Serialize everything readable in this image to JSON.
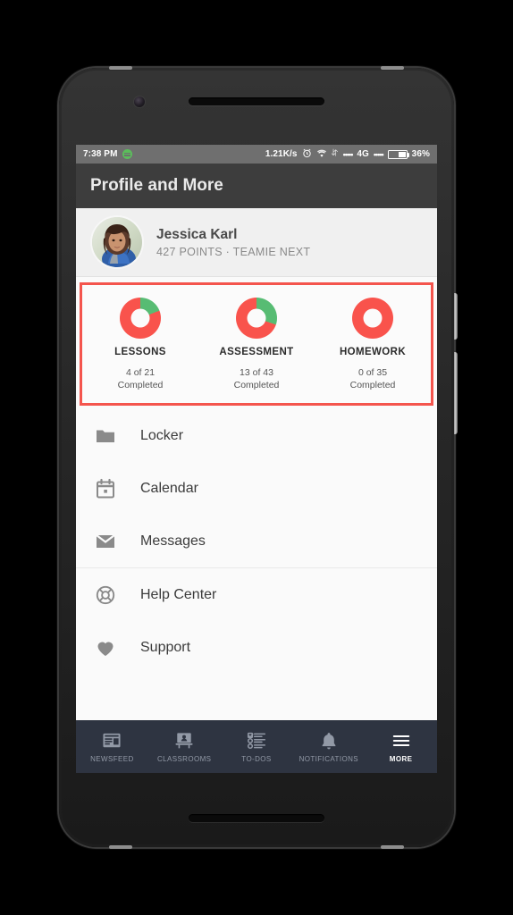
{
  "status_bar": {
    "time": "7:38 PM",
    "android_icon": "android-robot-icon",
    "net_speed": "1.21K/s",
    "alarm_icon": "alarm-clock-icon",
    "wifi_icon": "wifi-icon",
    "data_transfer_icon": "data-transfer-icon",
    "sim1_signal": "•••••",
    "network_type": "4G",
    "sim2_signal": "•••••",
    "battery_percent": "36%",
    "battery_level": 36
  },
  "app_bar": {
    "title": "Profile and More"
  },
  "profile": {
    "avatar": "user-avatar-photo",
    "name": "Jessica Karl",
    "meta": "427 POINTS  ·  TEAMIE NEXT",
    "points": "427 POINTS",
    "plan": "TEAMIE NEXT"
  },
  "progress_card": {
    "highlight_color": "#f4554d",
    "complete_color": "#57bc73",
    "remaining_color": "#f9534c",
    "items": [
      {
        "label": "LESSONS",
        "count": "4 of 21",
        "status": "Completed",
        "completed": 4,
        "total": 21
      },
      {
        "label": "ASSESSMENT",
        "count": "13 of 43",
        "status": "Completed",
        "completed": 13,
        "total": 43
      },
      {
        "label": "HOMEWORK",
        "count": "0 of 35",
        "status": "Completed",
        "completed": 0,
        "total": 35
      }
    ]
  },
  "menu": {
    "group1": [
      {
        "label": "Locker",
        "icon": "folder-icon"
      },
      {
        "label": "Calendar",
        "icon": "calendar-icon"
      },
      {
        "label": "Messages",
        "icon": "envelope-icon"
      }
    ],
    "group2": [
      {
        "label": "Help Center",
        "icon": "lifebuoy-icon"
      },
      {
        "label": "Support",
        "icon": "heart-icon"
      }
    ]
  },
  "bottom_nav": {
    "items": [
      {
        "label": "NEWSFEED",
        "icon": "newsfeed-icon",
        "active": false
      },
      {
        "label": "CLASSROOMS",
        "icon": "classroom-icon",
        "active": false
      },
      {
        "label": "TO-DOS",
        "icon": "checklist-icon",
        "active": false
      },
      {
        "label": "NOTIFICATIONS",
        "icon": "bell-icon",
        "active": false
      },
      {
        "label": "MORE",
        "icon": "hamburger-menu-icon",
        "active": true
      }
    ]
  }
}
